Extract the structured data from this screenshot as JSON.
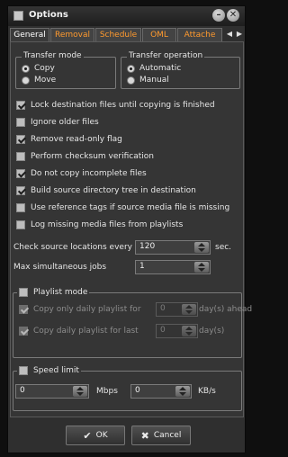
{
  "window": {
    "title": "Options"
  },
  "tabs": [
    "General",
    "Removal",
    "Schedule",
    "OML",
    "Attache"
  ],
  "transfer_mode": {
    "title": "Transfer mode",
    "options": [
      "Copy",
      "Move"
    ],
    "selected": "Copy"
  },
  "transfer_operation": {
    "title": "Transfer operation",
    "options": [
      "Automatic",
      "Manual"
    ],
    "selected": "Automatic"
  },
  "checkboxes": [
    {
      "label": "Lock destination files until copying is finished",
      "checked": true
    },
    {
      "label": "Ignore older files",
      "checked": false
    },
    {
      "label": "Remove read-only flag",
      "checked": true
    },
    {
      "label": "Perform checksum verification",
      "checked": false
    },
    {
      "label": "Do not copy incomplete files",
      "checked": true
    },
    {
      "label": "Build source directory tree in destination",
      "checked": true
    },
    {
      "label": "Use reference tags if source media file is missing",
      "checked": false
    },
    {
      "label": "Log missing media files from playlists",
      "checked": false
    }
  ],
  "check_interval": {
    "label": "Check source locations every",
    "value": "120",
    "unit": "sec."
  },
  "max_jobs": {
    "label": "Max simultaneous jobs",
    "value": "1"
  },
  "playlist_mode": {
    "label": "Playlist mode",
    "checked": false,
    "copy_ahead": {
      "label": "Copy only daily playlist for",
      "value": "0",
      "unit": "day(s) ahead",
      "checked": true
    },
    "copy_last": {
      "label": "Copy daily playlist for last",
      "value": "0",
      "unit": "day(s)",
      "checked": true
    }
  },
  "speed_limit": {
    "label": "Speed limit",
    "checked": false,
    "mbps": {
      "value": "0",
      "unit": "Mbps"
    },
    "kbs": {
      "value": "0",
      "unit": "KB/s"
    }
  },
  "buttons": {
    "ok": "OK",
    "cancel": "Cancel"
  },
  "icons": {
    "ok": "check-icon",
    "cancel": "x-icon"
  }
}
